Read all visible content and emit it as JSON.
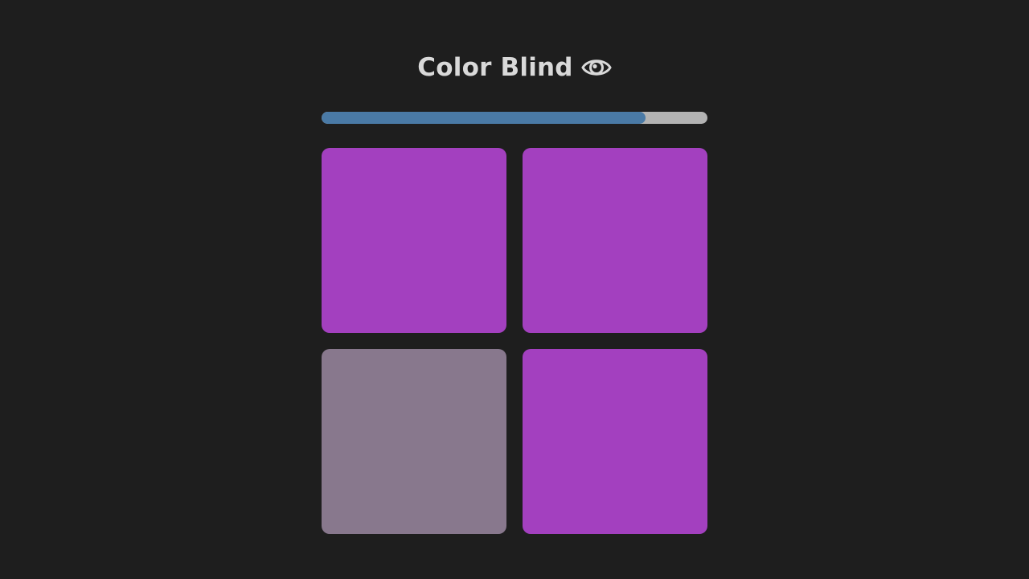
{
  "game": {
    "title": "Color Blind",
    "title_icon": "eye-icon"
  },
  "progress": {
    "fraction": 0.84,
    "fill_color": "#4a7aa6",
    "track_color": "#b3b3b3"
  },
  "board": {
    "base_color": "#a340bf",
    "odd_color": "#88788d",
    "tiles": [
      {
        "color": "#a340bf"
      },
      {
        "color": "#a340bf"
      },
      {
        "color": "#88788d"
      },
      {
        "color": "#a340bf"
      }
    ]
  },
  "colors": {
    "background": "#1e1e1e",
    "title_text": "#d9d9d9"
  }
}
